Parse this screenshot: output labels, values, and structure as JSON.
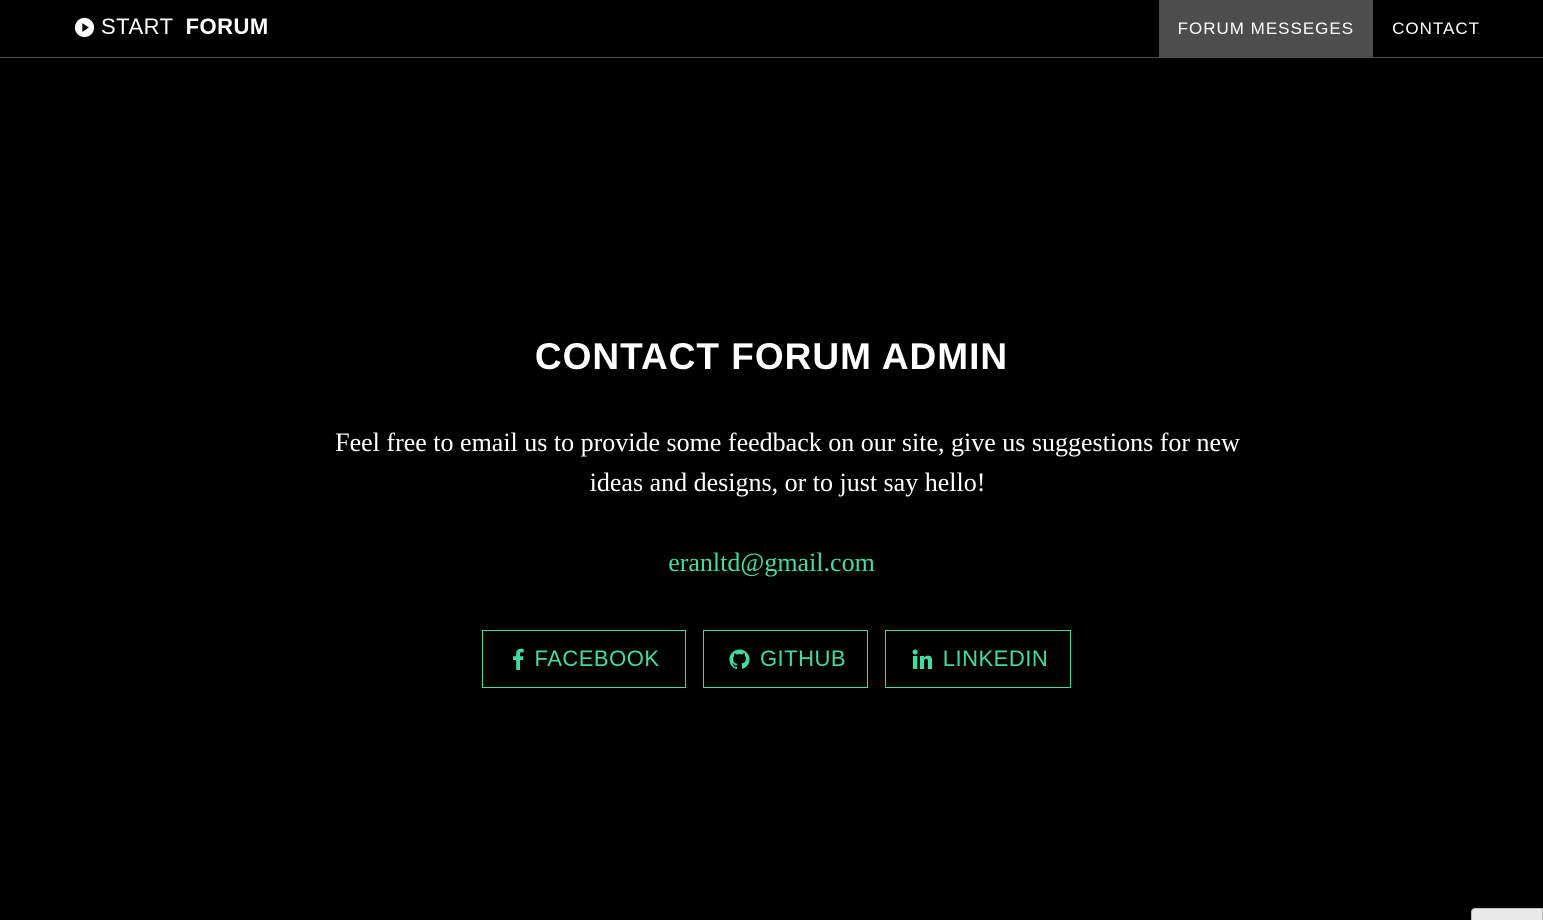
{
  "navbar": {
    "brand_light": "START",
    "brand_bold": "FORUM",
    "links": [
      {
        "label": "FORUM MESSEGES",
        "active": true
      },
      {
        "label": "CONTACT",
        "active": false
      }
    ]
  },
  "main": {
    "title": "CONTACT FORUM ADMIN",
    "blurb": "Feel free to email us to provide some feedback on our site, give us suggestions for new ideas and designs, or to just say hello!",
    "email": "eranltd@gmail.com"
  },
  "social": {
    "facebook_label": "FACEBOOK",
    "github_label": "GITHUB",
    "linkedin_label": "LINKEDIN",
    "icons": [
      "facebook-icon",
      "github-icon",
      "linkedin-icon"
    ]
  },
  "colors": {
    "background": "#000000",
    "accent": "#42dca3",
    "active_nav": "#4d4d4d",
    "text": "#ffffff"
  }
}
